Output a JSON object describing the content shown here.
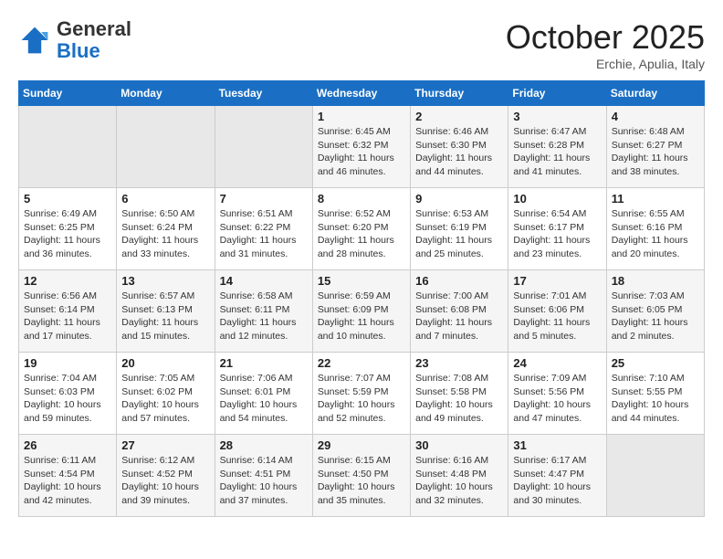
{
  "header": {
    "logo": {
      "general": "General",
      "blue": "Blue"
    },
    "title": "October 2025",
    "subtitle": "Erchie, Apulia, Italy"
  },
  "days_of_week": [
    "Sunday",
    "Monday",
    "Tuesday",
    "Wednesday",
    "Thursday",
    "Friday",
    "Saturday"
  ],
  "weeks": [
    [
      {
        "day": "",
        "info": ""
      },
      {
        "day": "",
        "info": ""
      },
      {
        "day": "",
        "info": ""
      },
      {
        "day": "1",
        "info": "Sunrise: 6:45 AM\nSunset: 6:32 PM\nDaylight: 11 hours\nand 46 minutes."
      },
      {
        "day": "2",
        "info": "Sunrise: 6:46 AM\nSunset: 6:30 PM\nDaylight: 11 hours\nand 44 minutes."
      },
      {
        "day": "3",
        "info": "Sunrise: 6:47 AM\nSunset: 6:28 PM\nDaylight: 11 hours\nand 41 minutes."
      },
      {
        "day": "4",
        "info": "Sunrise: 6:48 AM\nSunset: 6:27 PM\nDaylight: 11 hours\nand 38 minutes."
      }
    ],
    [
      {
        "day": "5",
        "info": "Sunrise: 6:49 AM\nSunset: 6:25 PM\nDaylight: 11 hours\nand 36 minutes."
      },
      {
        "day": "6",
        "info": "Sunrise: 6:50 AM\nSunset: 6:24 PM\nDaylight: 11 hours\nand 33 minutes."
      },
      {
        "day": "7",
        "info": "Sunrise: 6:51 AM\nSunset: 6:22 PM\nDaylight: 11 hours\nand 31 minutes."
      },
      {
        "day": "8",
        "info": "Sunrise: 6:52 AM\nSunset: 6:20 PM\nDaylight: 11 hours\nand 28 minutes."
      },
      {
        "day": "9",
        "info": "Sunrise: 6:53 AM\nSunset: 6:19 PM\nDaylight: 11 hours\nand 25 minutes."
      },
      {
        "day": "10",
        "info": "Sunrise: 6:54 AM\nSunset: 6:17 PM\nDaylight: 11 hours\nand 23 minutes."
      },
      {
        "day": "11",
        "info": "Sunrise: 6:55 AM\nSunset: 6:16 PM\nDaylight: 11 hours\nand 20 minutes."
      }
    ],
    [
      {
        "day": "12",
        "info": "Sunrise: 6:56 AM\nSunset: 6:14 PM\nDaylight: 11 hours\nand 17 minutes."
      },
      {
        "day": "13",
        "info": "Sunrise: 6:57 AM\nSunset: 6:13 PM\nDaylight: 11 hours\nand 15 minutes."
      },
      {
        "day": "14",
        "info": "Sunrise: 6:58 AM\nSunset: 6:11 PM\nDaylight: 11 hours\nand 12 minutes."
      },
      {
        "day": "15",
        "info": "Sunrise: 6:59 AM\nSunset: 6:09 PM\nDaylight: 11 hours\nand 10 minutes."
      },
      {
        "day": "16",
        "info": "Sunrise: 7:00 AM\nSunset: 6:08 PM\nDaylight: 11 hours\nand 7 minutes."
      },
      {
        "day": "17",
        "info": "Sunrise: 7:01 AM\nSunset: 6:06 PM\nDaylight: 11 hours\nand 5 minutes."
      },
      {
        "day": "18",
        "info": "Sunrise: 7:03 AM\nSunset: 6:05 PM\nDaylight: 11 hours\nand 2 minutes."
      }
    ],
    [
      {
        "day": "19",
        "info": "Sunrise: 7:04 AM\nSunset: 6:03 PM\nDaylight: 10 hours\nand 59 minutes."
      },
      {
        "day": "20",
        "info": "Sunrise: 7:05 AM\nSunset: 6:02 PM\nDaylight: 10 hours\nand 57 minutes."
      },
      {
        "day": "21",
        "info": "Sunrise: 7:06 AM\nSunset: 6:01 PM\nDaylight: 10 hours\nand 54 minutes."
      },
      {
        "day": "22",
        "info": "Sunrise: 7:07 AM\nSunset: 5:59 PM\nDaylight: 10 hours\nand 52 minutes."
      },
      {
        "day": "23",
        "info": "Sunrise: 7:08 AM\nSunset: 5:58 PM\nDaylight: 10 hours\nand 49 minutes."
      },
      {
        "day": "24",
        "info": "Sunrise: 7:09 AM\nSunset: 5:56 PM\nDaylight: 10 hours\nand 47 minutes."
      },
      {
        "day": "25",
        "info": "Sunrise: 7:10 AM\nSunset: 5:55 PM\nDaylight: 10 hours\nand 44 minutes."
      }
    ],
    [
      {
        "day": "26",
        "info": "Sunrise: 6:11 AM\nSunset: 4:54 PM\nDaylight: 10 hours\nand 42 minutes."
      },
      {
        "day": "27",
        "info": "Sunrise: 6:12 AM\nSunset: 4:52 PM\nDaylight: 10 hours\nand 39 minutes."
      },
      {
        "day": "28",
        "info": "Sunrise: 6:14 AM\nSunset: 4:51 PM\nDaylight: 10 hours\nand 37 minutes."
      },
      {
        "day": "29",
        "info": "Sunrise: 6:15 AM\nSunset: 4:50 PM\nDaylight: 10 hours\nand 35 minutes."
      },
      {
        "day": "30",
        "info": "Sunrise: 6:16 AM\nSunset: 4:48 PM\nDaylight: 10 hours\nand 32 minutes."
      },
      {
        "day": "31",
        "info": "Sunrise: 6:17 AM\nSunset: 4:47 PM\nDaylight: 10 hours\nand 30 minutes."
      },
      {
        "day": "",
        "info": ""
      }
    ]
  ]
}
